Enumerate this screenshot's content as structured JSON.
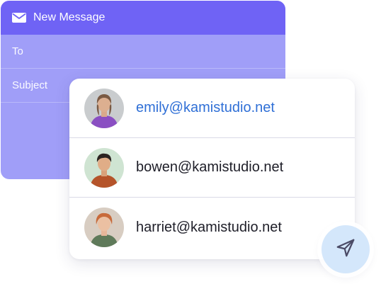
{
  "compose": {
    "title": "New Message",
    "fields": {
      "to_label": "To",
      "subject_label": "Subject"
    }
  },
  "contacts": [
    {
      "email": "emily@kamistudio.net",
      "active": true
    },
    {
      "email": "bowen@kamistudio.net",
      "active": false
    },
    {
      "email": "harriet@kamistudio.net",
      "active": false
    }
  ],
  "colors": {
    "header": "#6f63f5",
    "compose_body": "#a09ef8",
    "active_email": "#2f6fd6",
    "send_button_bg": "#d4e7fb"
  }
}
